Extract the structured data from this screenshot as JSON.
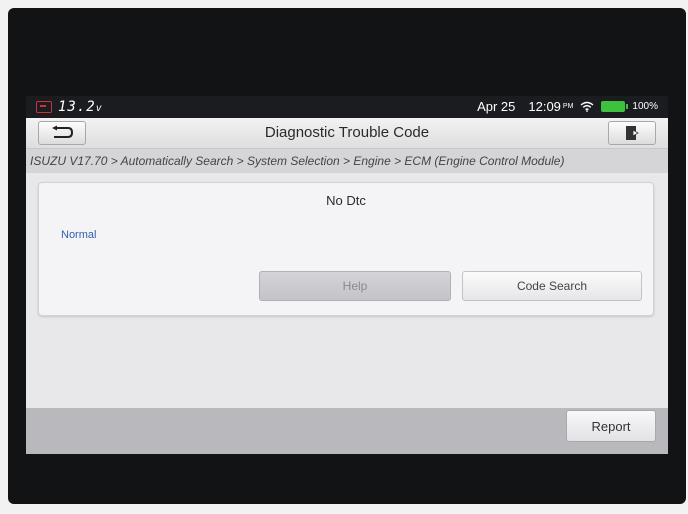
{
  "status_bar": {
    "voltage": "13.2",
    "voltage_unit": "v",
    "date": "Apr 25",
    "time": "12:09",
    "ampm": "PM",
    "battery": "100%",
    "icons": [
      "vci-icon",
      "wifi-icon",
      "battery-icon"
    ]
  },
  "header": {
    "title": "Diagnostic Trouble Code",
    "back_icon": "back-arrow-icon",
    "exit_icon": "exit-door-icon"
  },
  "breadcrumb": "ISUZU V17.70 > Automatically Search > System Selection > Engine > ECM (Engine Control Module)",
  "dtc_panel": {
    "heading": "No Dtc",
    "status": "Normal",
    "help_label": "Help",
    "code_search_label": "Code Search"
  },
  "footer": {
    "report_label": "Report"
  },
  "colors": {
    "status_text": "#2f5fae",
    "battery": "#3ec13e"
  }
}
